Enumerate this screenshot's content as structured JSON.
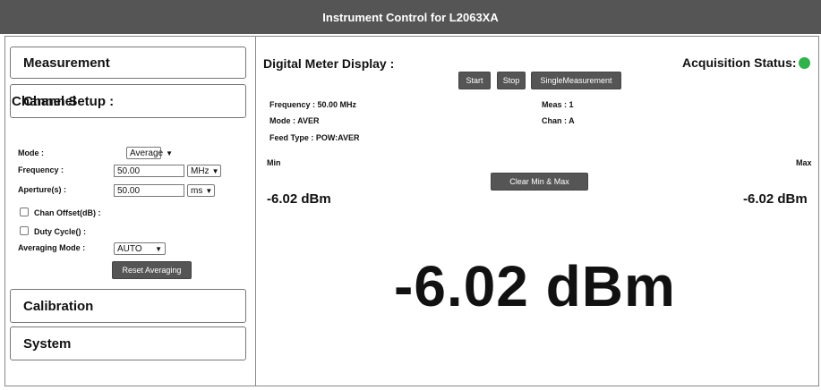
{
  "window": {
    "title": "Instrument Control for L2063XA"
  },
  "sidebar": {
    "panels": {
      "measurement": "Measurement",
      "channel": "Channel",
      "calibration": "Calibration",
      "system": "System"
    },
    "channel_setup": {
      "title": "Channel Setup :",
      "mode_label": "Mode :",
      "mode_value": "Average",
      "frequency_label": "Frequency :",
      "frequency_value": "50.00",
      "frequency_unit": "MHz",
      "aperture_label": "Aperture(s) :",
      "aperture_value": "50.00",
      "aperture_unit": "ms",
      "chan_offset_label": "Chan Offset(dB) :",
      "duty_cycle_label": "Duty Cycle() :",
      "averaging_mode_label": "Averaging Mode :",
      "averaging_mode_value": "AUTO",
      "reset_button": "Reset Averaging"
    }
  },
  "display": {
    "title": "Digital Meter Display :",
    "acquisition_label": "Acquisition Status:",
    "acquisition_color": "#2fb34a",
    "buttons": {
      "start": "Start",
      "stop": "Stop",
      "single": "SingleMeasurement",
      "clear": "Clear Min & Max"
    },
    "info": {
      "frequency": "Frequency : 50.00 MHz",
      "mode": "Mode : AVER",
      "feed_type": "Feed Type : POW:AVER",
      "meas": "Meas : 1",
      "chan": "Chan : A"
    },
    "min_label": "Min",
    "max_label": "Max",
    "min_value": "-6.02 dBm",
    "max_value": "-6.02 dBm",
    "main_value": "-6.02 dBm"
  }
}
